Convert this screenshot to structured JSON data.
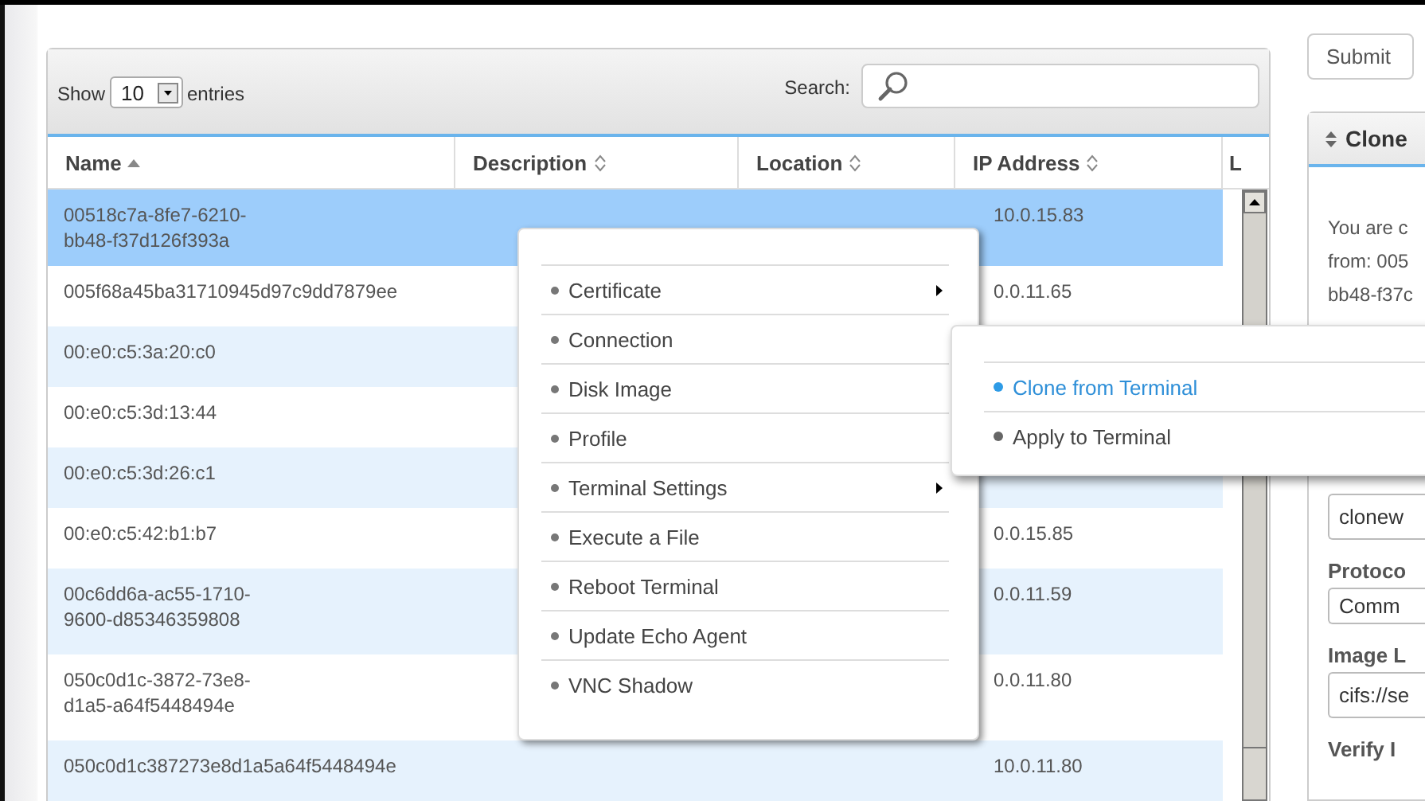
{
  "toolbar": {
    "show_label": "Show",
    "page_size": "10",
    "entries_label": "entries",
    "search_label": "Search:"
  },
  "table": {
    "columns": [
      {
        "label": "Name",
        "sorted": true
      },
      {
        "label": "Description",
        "sorted": false
      },
      {
        "label": "Location",
        "sorted": false
      },
      {
        "label": "IP Address",
        "sorted": false
      },
      {
        "label": "L"
      }
    ],
    "rows": [
      {
        "name": "00518c7a-8fe7-6210-bb48-f37d126f393a",
        "ip": "10.0.15.83",
        "selected": true
      },
      {
        "name": "005f68a45ba31710945d97c9dd7879ee",
        "ip": "0.0.11.65",
        "selected": false
      },
      {
        "name": "00:e0:c5:3a:20:c0",
        "selected": false
      },
      {
        "name": "00:e0:c5:3d:13:44",
        "selected": false
      },
      {
        "name": "00:e0:c5:3d:26:c1",
        "selected": false
      },
      {
        "name": "00:e0:c5:42:b1:b7",
        "ip": "0.0.15.85",
        "selected": false
      },
      {
        "name": "00c6dd6a-ac55-1710-9600-d85346359808",
        "ip": "0.0.11.59",
        "selected": false
      },
      {
        "name": "050c0d1c-3872-73e8-d1a5-a64f5448494e",
        "ip": "0.0.11.80",
        "selected": false
      },
      {
        "name": "050c0d1c387273e8d1a5a64f5448494e",
        "ip": "10.0.11.80",
        "selected": false
      }
    ]
  },
  "context_menu": {
    "items": [
      {
        "label": "Certificate",
        "has_submenu": true
      },
      {
        "label": "Connection",
        "has_submenu": false
      },
      {
        "label": "Disk Image",
        "has_submenu": false
      },
      {
        "label": "Profile",
        "has_submenu": false
      },
      {
        "label": "Terminal Settings",
        "has_submenu": true
      },
      {
        "label": "Execute a File",
        "has_submenu": false
      },
      {
        "label": "Reboot Terminal",
        "has_submenu": false
      },
      {
        "label": "Update Echo Agent",
        "has_submenu": false
      },
      {
        "label": "VNC Shadow",
        "has_submenu": false
      }
    ]
  },
  "submenu": {
    "items": [
      {
        "label": "Clone from Terminal",
        "selected": true
      },
      {
        "label": "Apply to Terminal",
        "selected": false
      }
    ]
  },
  "side_panel": {
    "submit_label": "Submit",
    "title": "Clone",
    "intro_lines": [
      "You are c",
      "from: 005",
      "bb48-f37c"
    ],
    "fields": [
      {
        "kind": "input",
        "value": "clonew"
      },
      {
        "kind": "select",
        "label": "Protoco",
        "value": "Comm"
      },
      {
        "kind": "input",
        "label": "Image L",
        "value": "cifs://se"
      },
      {
        "kind": "heading",
        "label": "Verify I"
      }
    ]
  }
}
